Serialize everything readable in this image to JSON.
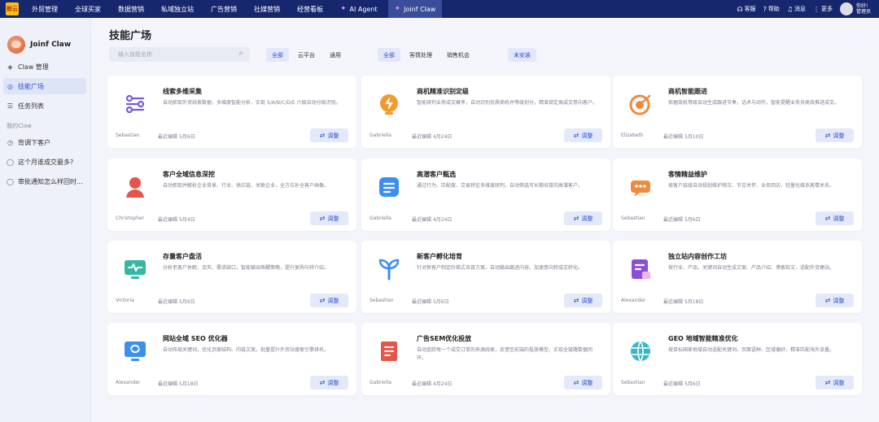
{
  "topbar": {
    "logo_text": "鲸云",
    "nav": [
      "外贸管理",
      "全球买家",
      "数据营销",
      "私域独立站",
      "广告营销",
      "社媒营销",
      "经营看板"
    ],
    "ai_agent": "AI Agent",
    "joinf_claw": "Joinf Claw",
    "right": {
      "service": "客服",
      "help": "帮助",
      "messages": "消息",
      "more": "更多",
      "user_line1": "你好!",
      "user_line2": "管理员"
    }
  },
  "sidebar": {
    "brand": "Joinf Claw",
    "items": [
      {
        "label": "Claw 管理",
        "icon": "cube-icon"
      },
      {
        "label": "技能广场",
        "icon": "compass-icon"
      },
      {
        "label": "任务列表",
        "icon": "list-icon"
      }
    ],
    "group_label": "我的Claw",
    "my_items": [
      {
        "label": "背调下客户",
        "icon": "history-icon"
      },
      {
        "label": "这个月谁成交最多?",
        "icon": "chat-icon"
      },
      {
        "label": "审批通知怎么样回时...",
        "icon": "chat-icon"
      }
    ]
  },
  "main": {
    "title": "技能广场",
    "search_placeholder": "输入技能名称",
    "filter1": [
      "全部",
      "云平台",
      "通用"
    ],
    "filter2": [
      "全部",
      "客情处理",
      "销售机会"
    ],
    "filter3": [
      "未安装"
    ],
    "button_label": "调整",
    "date_prefix": "最近编辑",
    "cards": [
      {
        "title": "线索多维采集",
        "desc": "自动抓取外贸线索数据，多维度智能分析，实现 S/A/B/C/D/E 六级自动分级识别。",
        "author": "Sebastian",
        "date": "5月6日",
        "icon": "network-icon",
        "color": "#6f5ed8"
      },
      {
        "title": "商机精准识别定级",
        "desc": "智能研判业务成交概率，自动识别优质商机并等级划分，精准锁定高成交意向客户。",
        "author": "Gabriella",
        "date": "4月24日",
        "icon": "lightning-icon",
        "color": "#f29a2e"
      },
      {
        "title": "商机智能跟进",
        "desc": "依据商机等级自动生成跟进节奏，话术与动作，智能提醒业务员高效推进成交。",
        "author": "Elizabeth",
        "date": "5月10日",
        "icon": "target-icon",
        "color": "#f08a3c"
      },
      {
        "title": "客户全域信息深挖",
        "desc": "自动抓取并解析企业背景、行业、供应链、关联企业，全方位补全客户画像。",
        "author": "Christopher",
        "date": "5月4日",
        "icon": "user-icon",
        "color": "#e5554b"
      },
      {
        "title": "高潜客户甄选",
        "desc": "通过行为、匹配度、交易特征多维度研判，自动筛选可长期培育的高潜客户。",
        "author": "Gabriella",
        "date": "4月24日",
        "icon": "document-icon",
        "color": "#3b8fee"
      },
      {
        "title": "客情精益维护",
        "desc": "按客户层级自动规划维护频次、节日关怀、业务回访，轻量化维系客情关系。",
        "author": "Sebastian",
        "date": "5月6日",
        "icon": "chat-bubble-icon",
        "color": "#f08a3c"
      },
      {
        "title": "存量客户盘活",
        "desc": "分析老客户休眠、流失、需求缺口，智能输出唤醒策略，提升复购与转介绍。",
        "author": "Victoria",
        "date": "5月6日",
        "icon": "pulse-monitor-icon",
        "color": "#35b8a2"
      },
      {
        "title": "新客户孵化培育",
        "desc": "针对新客户制定阶梯式培育方案，自动输出跟进内容，加速意向转成交转化。",
        "author": "Sebastian",
        "date": "5月6日",
        "icon": "sprout-icon",
        "color": "#3b8fee"
      },
      {
        "title": "独立站内容创作工坊",
        "desc": "按行业、产品、关键词自动生成文案、产品介绍、博客软文，适配外贸建站。",
        "author": "Alexander",
        "date": "5月18日",
        "icon": "doc-edit-icon",
        "color": "#8a4fd6"
      },
      {
        "title": "网站全域 SEO 优化器",
        "desc": "自动布局关键词，优化页面结构、内链文案，批量提升外贸站搜索引擎排名。",
        "author": "Alexander",
        "date": "5月18日",
        "icon": "refresh-screen-icon",
        "color": "#3b8fee"
      },
      {
        "title": "广告SEM优化投放",
        "desc": "自动追踪每一个成交订单的来源线索，反馈至前端的投放模型，实现全链路数据闭环。",
        "author": "Gabriella",
        "date": "4月24日",
        "icon": "file-icon",
        "color": "#e5554b"
      },
      {
        "title": "GEO 地域智能精准优化",
        "desc": "按目标国家地域自动适配关键词、页面语种、区域偏好，精准匹配海外流量。",
        "author": "Sebastian",
        "date": "5月6日",
        "icon": "globe-icon",
        "color": "#35b8c9"
      }
    ]
  }
}
